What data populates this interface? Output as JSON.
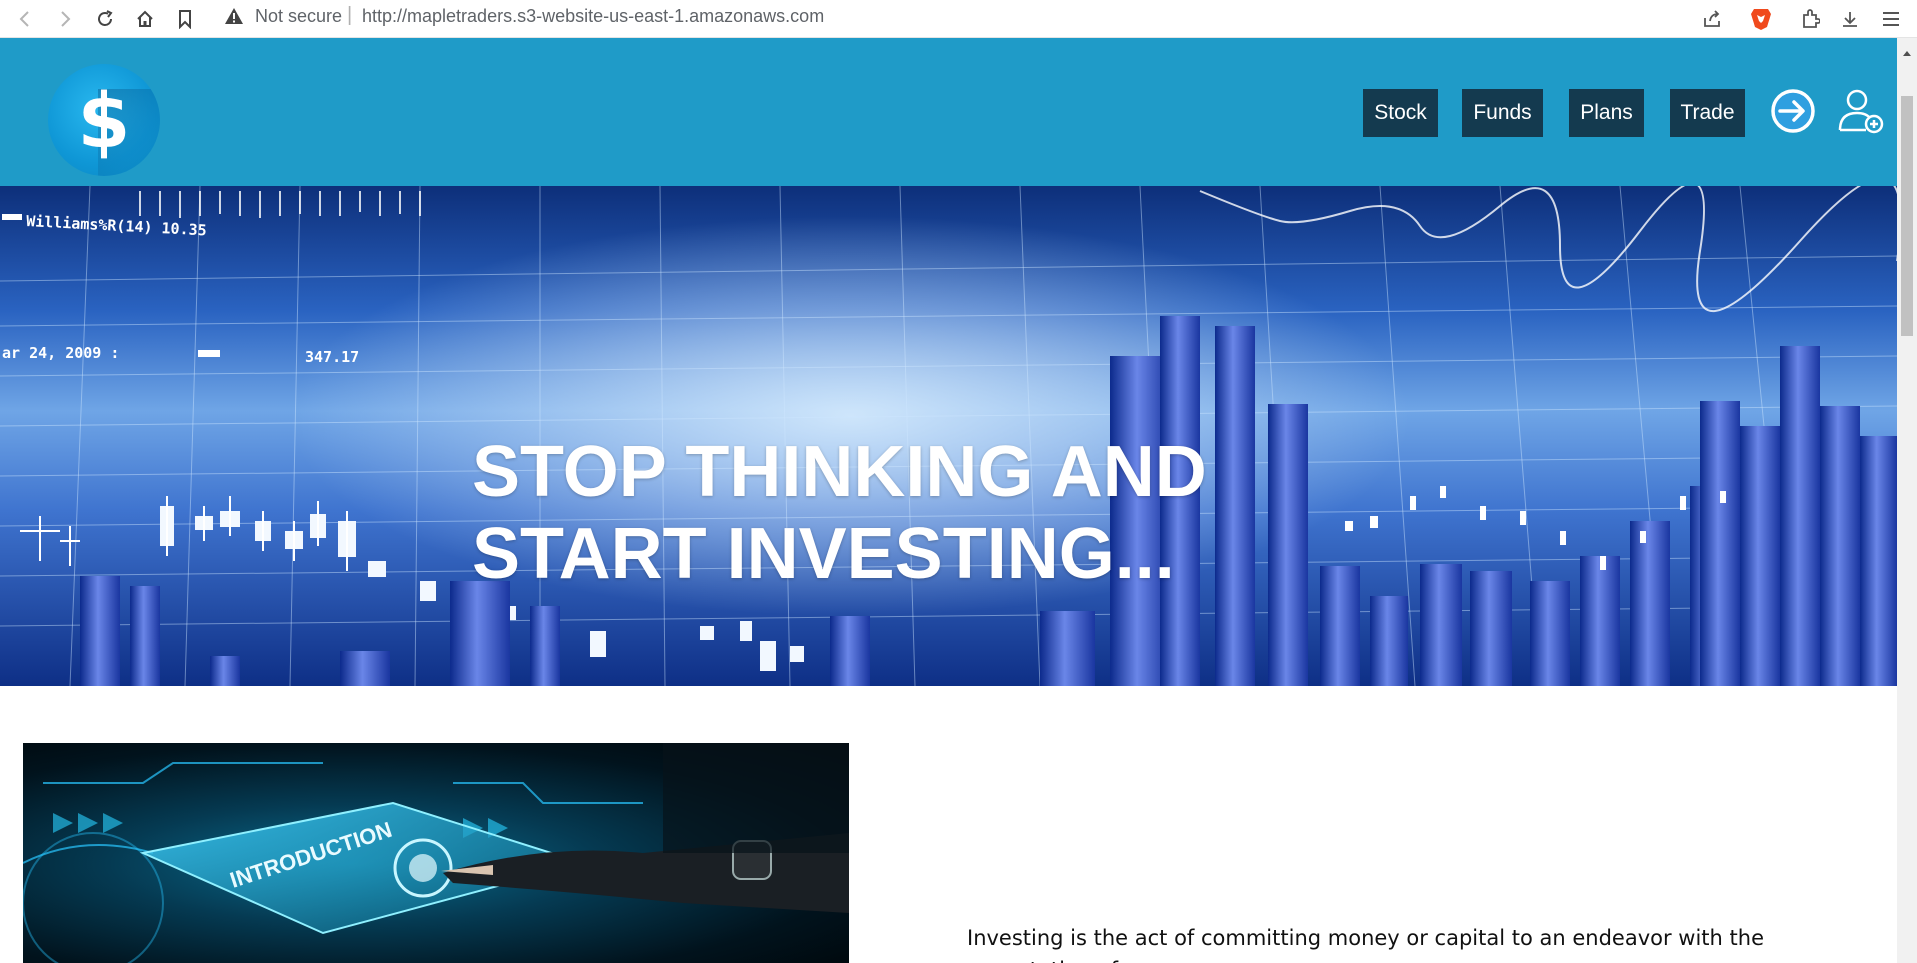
{
  "browser": {
    "security_label": "Not secure",
    "url": "http://mapletraders.s3-website-us-east-1.amazonaws.com",
    "icons": [
      "back-icon",
      "forward-icon",
      "reload-icon",
      "home-icon",
      "bookmark-icon",
      "warning-icon",
      "share-icon",
      "brave-shield-icon",
      "extensions-icon",
      "download-icon",
      "menu-icon"
    ]
  },
  "header": {
    "logo_glyph": "$",
    "nav": [
      {
        "label": "Stock"
      },
      {
        "label": "Funds"
      },
      {
        "label": "Plans"
      },
      {
        "label": "Trade"
      }
    ],
    "login_icon": "login-arrow-icon",
    "signup_icon": "add-user-icon",
    "brand_color": "#1f9bc8",
    "nav_bg_color": "#143a4f"
  },
  "hero": {
    "title_line1": "STOP THINKING AND",
    "title_line2": "START INVESTING...",
    "chart_text": {
      "indicator": "Williams%R(14) 10.35",
      "date": "ar 24, 2009 :",
      "value": "347.17"
    }
  },
  "intro": {
    "image_label": "INTRODUCTION",
    "text": "Investing is the act of committing money or capital to an endeavor with the expectation of"
  }
}
